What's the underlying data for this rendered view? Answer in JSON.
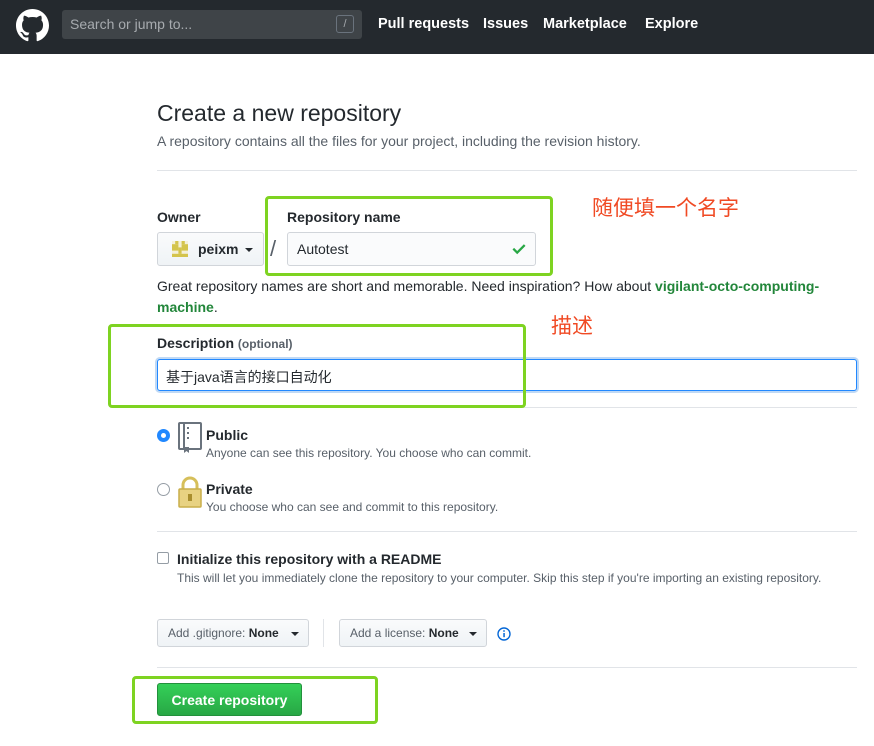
{
  "header": {
    "logo_icon": "github-mark-icon",
    "search_placeholder": "Search or jump to...",
    "search_shortcut": "/",
    "nav": [
      "Pull requests",
      "Issues",
      "Marketplace",
      "Explore"
    ]
  },
  "page": {
    "title": "Create a new repository",
    "subtitle": "A repository contains all the files for your project, including the revision history."
  },
  "owner": {
    "label": "Owner",
    "value": "peixm"
  },
  "repo_name": {
    "label": "Repository name",
    "value": "Autotest",
    "separator": "/"
  },
  "hint": {
    "text": "Great repository names are short and memorable. Need inspiration? How about ",
    "suggestion": "vigilant-octo-computing-machine",
    "end": "."
  },
  "description": {
    "label": "Description",
    "optional": "(optional)",
    "value": "基于java语言的接口自动化"
  },
  "visibility": {
    "public_title": "Public",
    "public_desc": "Anyone can see this repository. You choose who can commit.",
    "private_title": "Private",
    "private_desc": "You choose who can see and commit to this repository.",
    "selected": "public"
  },
  "init": {
    "title": "Initialize this repository with a README",
    "desc": "This will let you immediately clone the repository to your computer. Skip this step if you're importing an existing repository.",
    "checked": false
  },
  "gitignore": {
    "label": "Add .gitignore:",
    "value": "None"
  },
  "license": {
    "label": "Add a license:",
    "value": "None"
  },
  "create_button": "Create repository",
  "annotations": {
    "name_note": "随便填一个名字",
    "desc_note": "描述",
    "box_color": "#7ed321",
    "text_color": "#f04a24"
  },
  "colors": {
    "header_bg": "#24292e",
    "primary_green": "#28a745",
    "focus_blue": "#2188ff"
  }
}
